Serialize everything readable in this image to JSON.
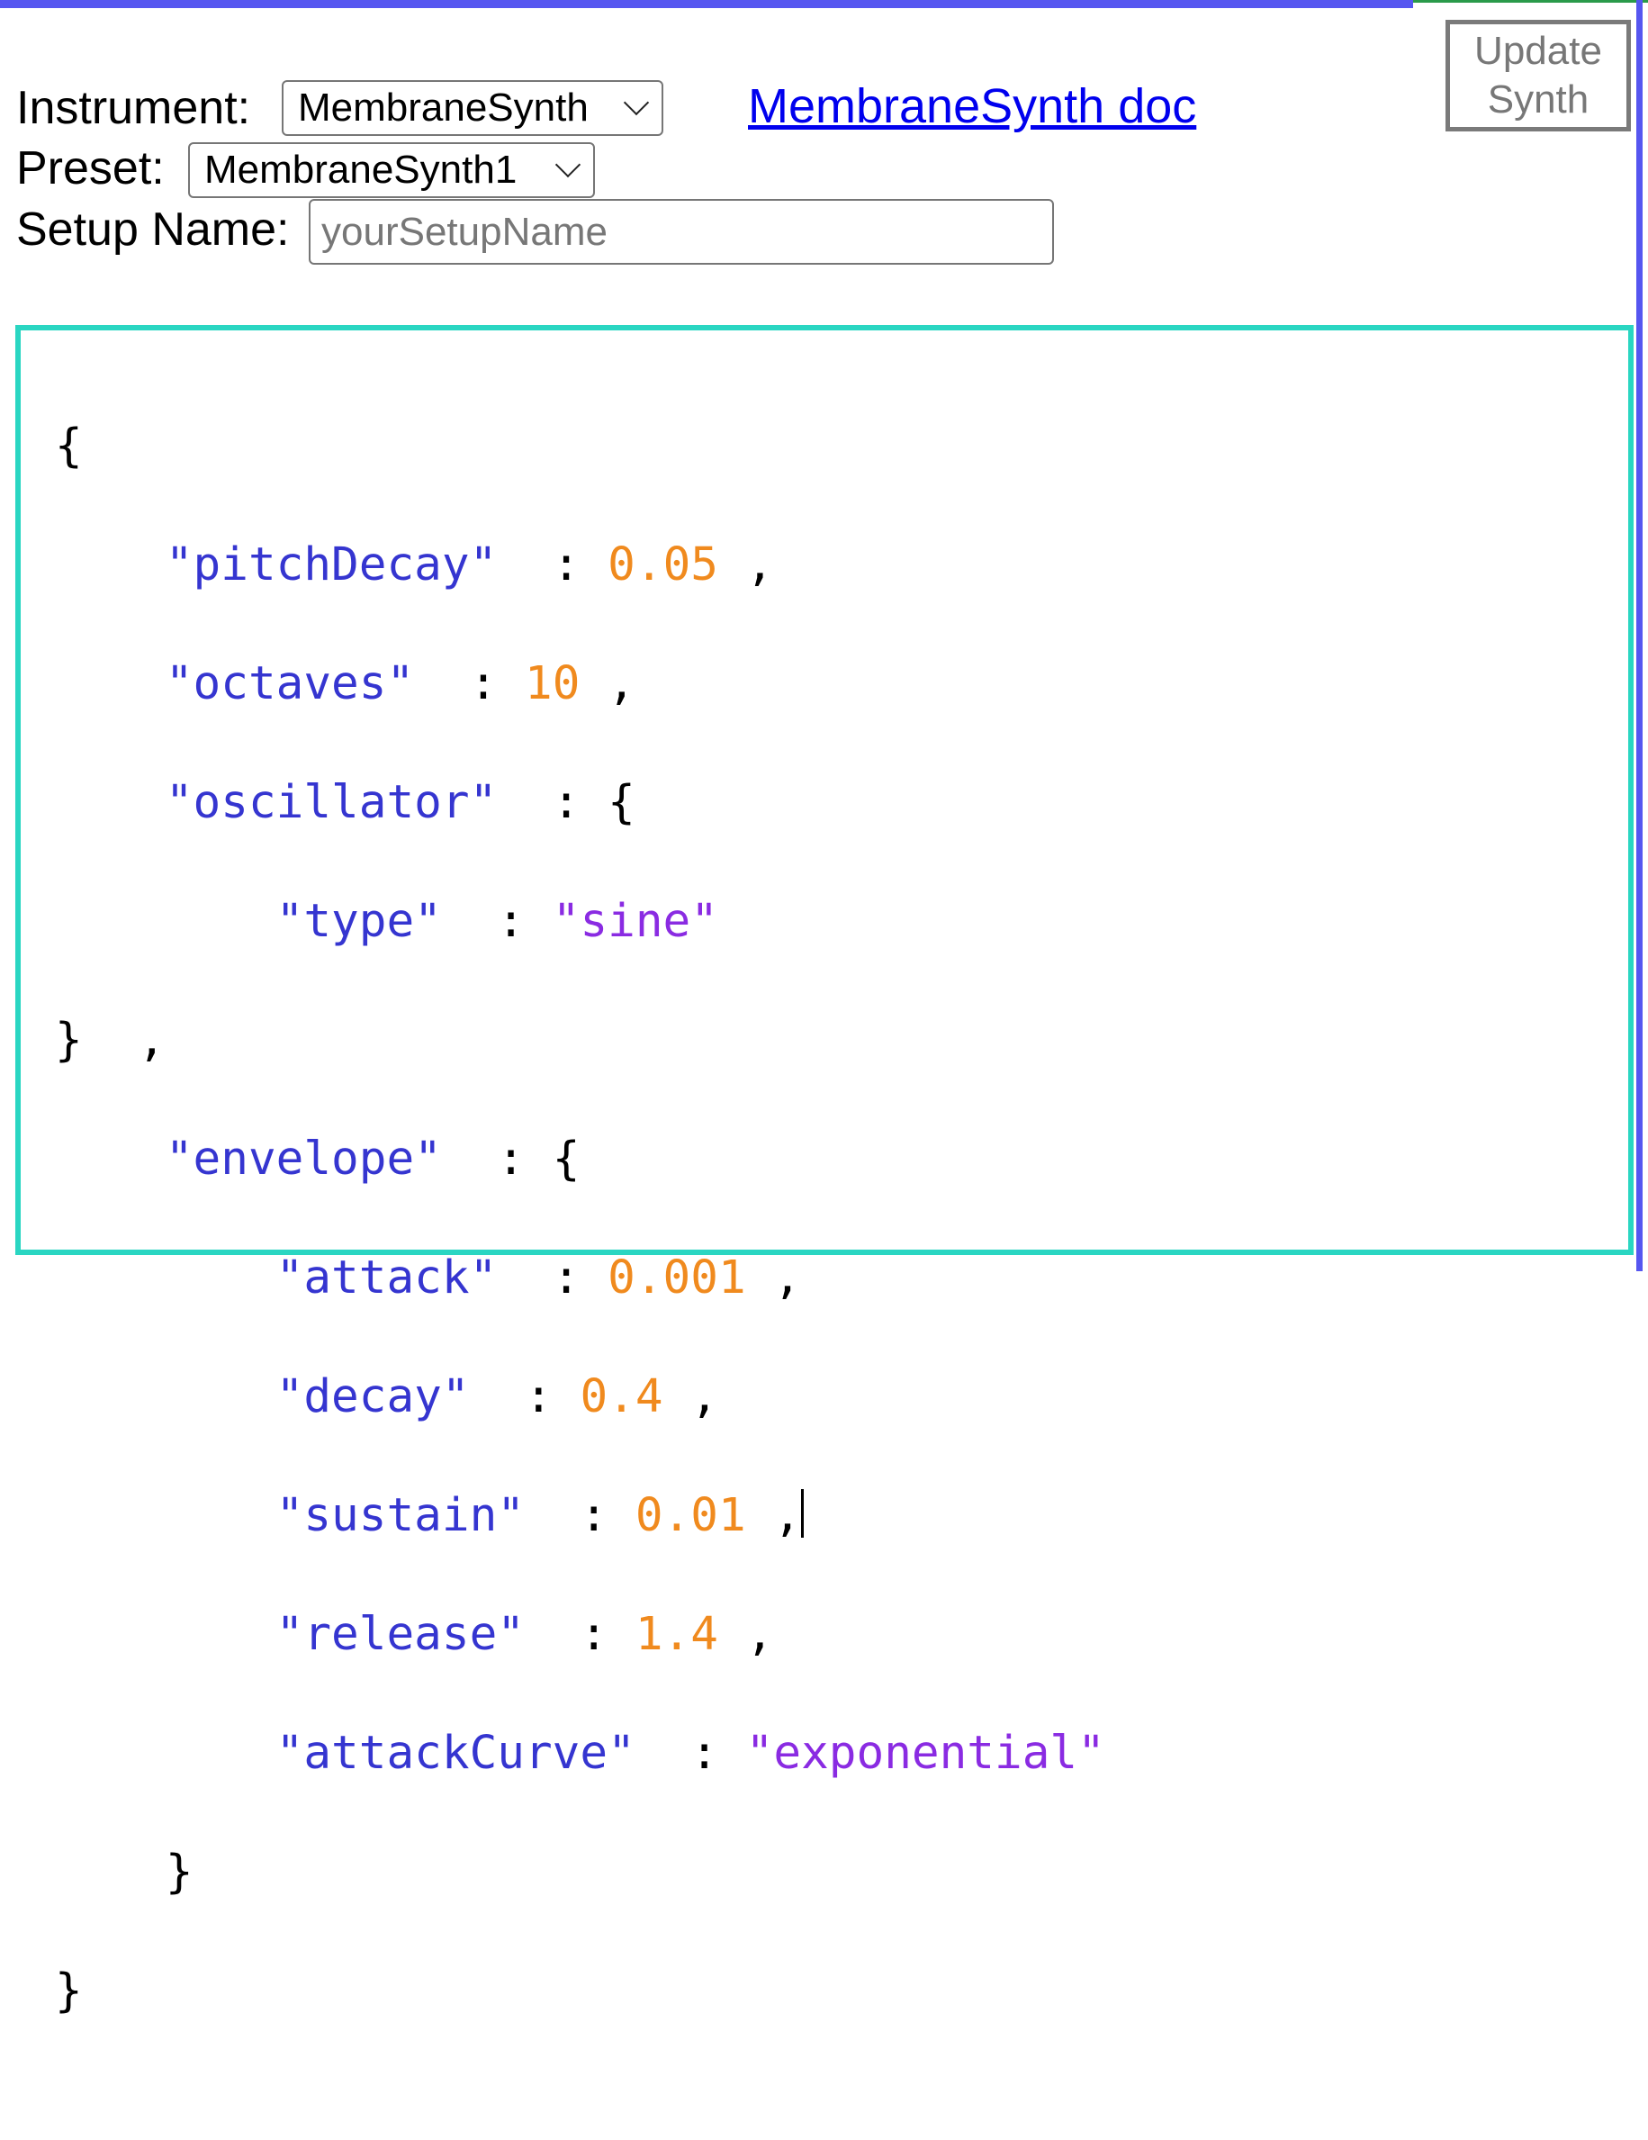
{
  "instrument": {
    "label": "Instrument:",
    "selected": "MembraneSynth"
  },
  "doc_link": {
    "text": "MembraneSynth doc"
  },
  "update_button": {
    "line1": "Update",
    "line2": "Synth"
  },
  "preset": {
    "label": "Preset:",
    "selected": "MembraneSynth1"
  },
  "setup_name": {
    "label": "Setup Name:",
    "value": "",
    "placeholder": "yourSetupName"
  },
  "code": {
    "open_brace": "{",
    "pitchDecay_key": "\"pitchDecay\"",
    "pitchDecay_val": "0.05",
    "octaves_key": "\"octaves\"",
    "octaves_val": "10",
    "oscillator_key": "\"oscillator\"",
    "type_key": "\"type\"",
    "type_val": "\"sine\"",
    "envelope_key": "\"envelope\"",
    "attack_key": "\"attack\"",
    "attack_val": "0.001",
    "decay_key": "\"decay\"",
    "decay_val": "0.4",
    "sustain_key": "\"sustain\"",
    "sustain_val": "0.01",
    "release_key": "\"release\"",
    "release_val": "1.4",
    "attackCurve_key": "\"attackCurve\"",
    "attackCurve_val": "\"exponential\"",
    "close_brace": "}"
  },
  "colors": {
    "key": "#3535d0",
    "number": "#f08a1e",
    "string": "#8a2be2",
    "editor_border": "#2ad6c2",
    "page_border": "#5656f0",
    "link": "#0000ee"
  }
}
